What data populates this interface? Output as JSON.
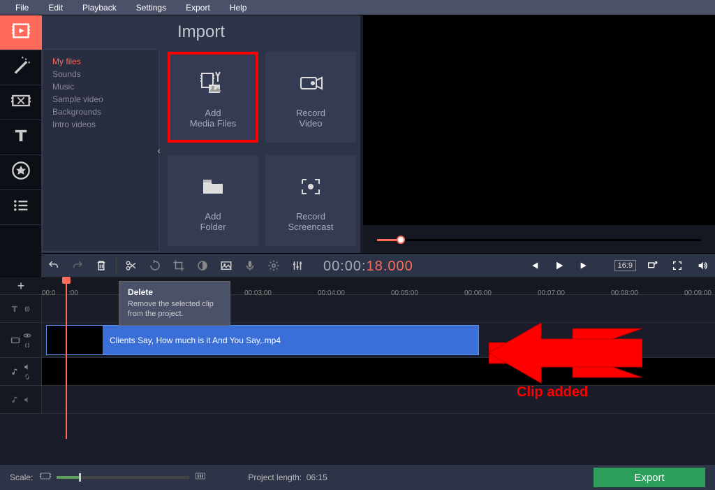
{
  "menubar": {
    "file": "File",
    "edit": "Edit",
    "playback": "Playback",
    "settings": "Settings",
    "export": "Export",
    "help": "Help"
  },
  "import": {
    "title": "Import",
    "categories": {
      "my_files": "My files",
      "sounds": "Sounds",
      "music": "Music",
      "sample_video": "Sample video",
      "backgrounds": "Backgrounds",
      "intro_videos": "Intro videos"
    },
    "tiles": {
      "add_media_l1": "Add",
      "add_media_l2": "Media Files",
      "record_video_l1": "Record",
      "record_video_l2": "Video",
      "add_folder_l1": "Add",
      "add_folder_l2": "Folder",
      "record_screencast_l1": "Record",
      "record_screencast_l2": "Screencast"
    }
  },
  "timecode": {
    "hms": "00:00:",
    "sec": "18.000"
  },
  "aspect_ratio": "16:9",
  "ruler": {
    "t0a": "00:0",
    "t0b": ":00",
    "t3": "00:03:00",
    "t4": "00:04:00",
    "t5": "00:05:00",
    "t6": "00:06:00",
    "t7": "00:07:00",
    "t8": "00:08:00",
    "t9": "00:09:00"
  },
  "clip": {
    "name": "Clients Say, How much is it And You Say,.mp4"
  },
  "tooltip": {
    "title": "Delete",
    "body": "Remove the selected clip from the project."
  },
  "annotation": {
    "label": "Clip added"
  },
  "footer": {
    "scale_label": "Scale:",
    "project_length_label": "Project length:",
    "project_length_value": "06:15",
    "export": "Export"
  }
}
